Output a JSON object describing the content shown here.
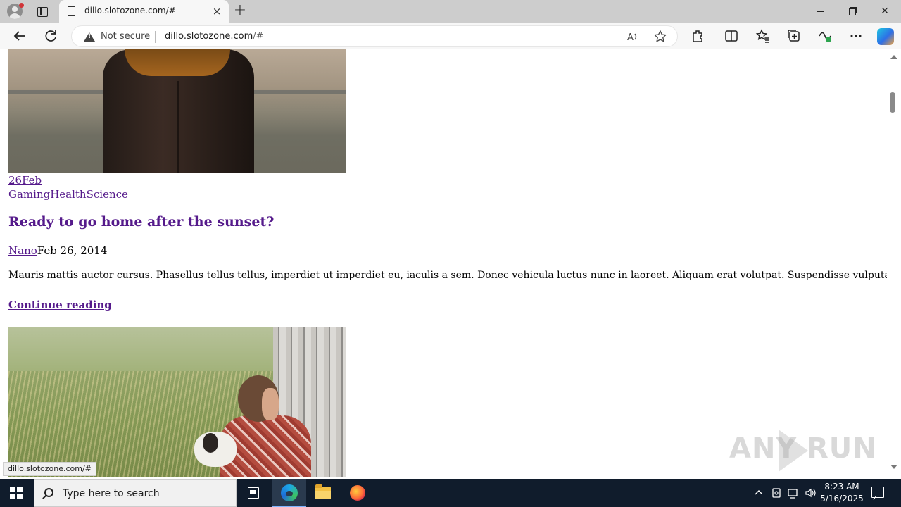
{
  "browser": {
    "tab_title": "dillo.slotozone.com/#",
    "security_label": "Not secure",
    "url_host": "dillo.slotozone.com",
    "url_path": "/#",
    "status_url": "dillo.slotozone.com/#"
  },
  "page": {
    "post1": {
      "date_link": "26Feb",
      "categories": "GamingHealthScience",
      "title": "Ready to go home after the sunset?",
      "author": "Nano",
      "date": "Feb 26, 2014",
      "excerpt": "Mauris mattis auctor cursus. Phasellus tellus tellus, imperdiet ut imperdiet eu, iaculis a sem. Donec vehicula luctus nunc in laoreet. Aliquam erat volutpat. Suspendisse vulputate porttitor condimentum....",
      "continue_label": "Continue reading"
    }
  },
  "watermark": {
    "left": "ANY",
    "right": "RUN"
  },
  "taskbar": {
    "search_placeholder": "Type here to search",
    "time": "8:23 AM",
    "date": "5/16/2025"
  },
  "icons": {
    "tab_close": "×",
    "new_tab": "+",
    "win_close": "✕"
  }
}
